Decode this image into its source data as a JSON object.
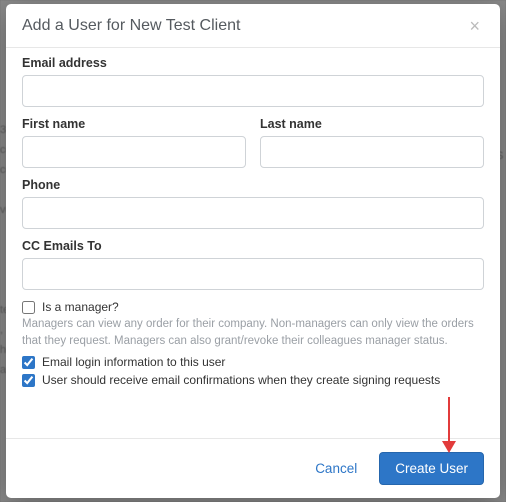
{
  "modal": {
    "title": "Add a User for New Test Client",
    "close_glyph": "×"
  },
  "fields": {
    "email": {
      "label": "Email address",
      "value": ""
    },
    "first_name": {
      "label": "First name",
      "value": ""
    },
    "last_name": {
      "label": "Last name",
      "value": ""
    },
    "phone": {
      "label": "Phone",
      "value": ""
    },
    "cc_emails": {
      "label": "CC Emails To",
      "value": ""
    }
  },
  "checkboxes": {
    "is_manager": {
      "label": "Is a manager?",
      "checked": false
    },
    "manager_help": "Managers can view any order for their company. Non-managers can only view the orders that they request. Managers can also grant/revoke their colleagues manager status.",
    "email_login": {
      "label": "Email login information to this user",
      "checked": true
    },
    "email_confirm": {
      "label": "User should receive email confirmations when they create signing requests",
      "checked": true
    }
  },
  "footer": {
    "cancel": "Cancel",
    "submit": "Create User"
  }
}
